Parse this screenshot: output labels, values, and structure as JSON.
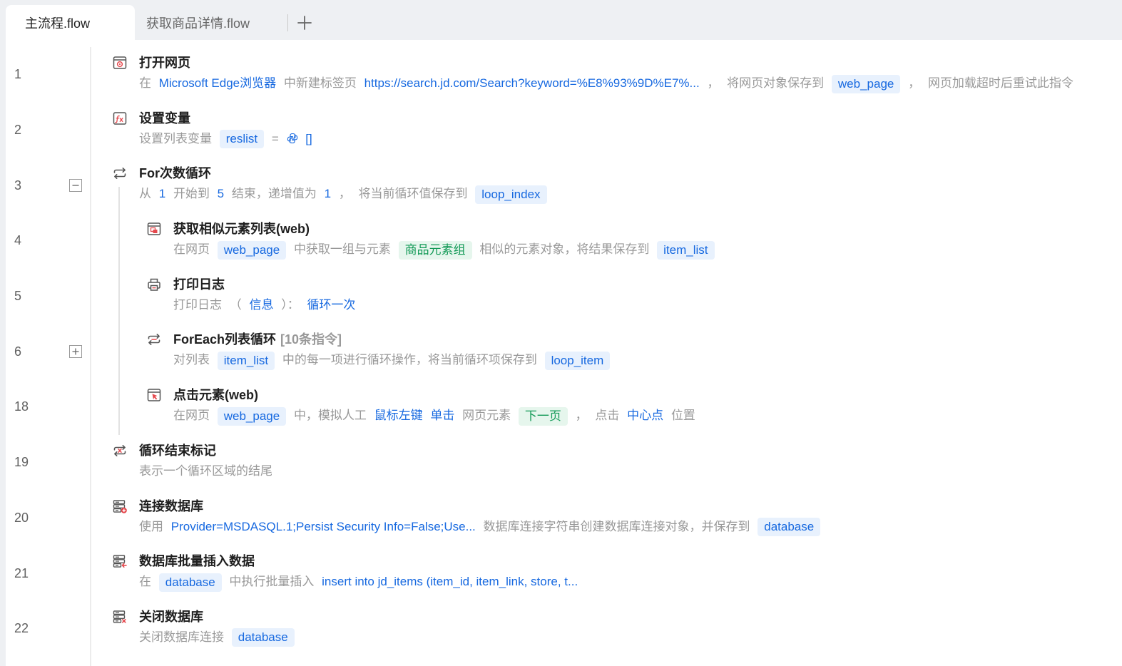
{
  "tabs": [
    {
      "label": "主流程.flow"
    },
    {
      "label": "获取商品详情.flow"
    }
  ],
  "colors": {
    "value_blue": "#1769e0",
    "tag_blue_bg": "#e8f1fd",
    "element_green": "#139a57",
    "tag_green_bg": "#e6f6ed",
    "muted_text": "#999999",
    "icon_red": "#e5484d",
    "icon_gray": "#555555"
  },
  "rows": [
    {
      "line": "1",
      "icon": "open-webpage-icon",
      "title": "打开网页",
      "desc": [
        "在",
        "Microsoft Edge浏览器",
        "中新建标签页",
        "https://search.jd.com/Search?keyword=%E8%93%9D%E7%...",
        "，",
        "将网页对象保存到",
        "web_page",
        "，",
        "网页加载超时后重试此指令"
      ]
    },
    {
      "line": "2",
      "icon": "set-variable-icon",
      "title": "设置变量",
      "value_icon": "python-icon",
      "desc": [
        "设置列表变量",
        "reslist",
        "=",
        "[]"
      ]
    },
    {
      "line": "3",
      "icon": "loop-icon",
      "title": "For次数循环",
      "fold_icon": "minus-icon",
      "desc": [
        "从",
        "1",
        "开始到",
        "5",
        "结束，递增值为",
        "1",
        "，",
        "将当前循环值保存到",
        "loop_index"
      ]
    },
    {
      "line": "4",
      "icon": "similar-elements-icon",
      "title": "获取相似元素列表(web)",
      "desc": [
        "在网页",
        "web_page",
        "中获取一组与元素",
        "商品元素组",
        "相似的元素对象，将结果保存到",
        "item_list"
      ]
    },
    {
      "line": "5",
      "icon": "print-icon",
      "title": "打印日志",
      "desc": [
        "打印日志",
        "（",
        "信息",
        "）：",
        "循环一次"
      ]
    },
    {
      "line": "6",
      "icon": "foreach-loop-icon",
      "title": "ForEach列表循环",
      "title_suffix": "[10条指令]",
      "fold_icon": "plus-icon",
      "desc": [
        "对列表",
        "item_list",
        "中的每一项进行循环操作，将当前循环项保存到",
        "loop_item"
      ]
    },
    {
      "line": "18",
      "icon": "click-element-icon",
      "title": "点击元素(web)",
      "desc": [
        "在网页",
        "web_page",
        "中，模拟人工",
        "鼠标左键",
        "单击",
        "网页元素",
        "下一页",
        "，",
        "点击",
        "中心点",
        "位置"
      ]
    },
    {
      "line": "19",
      "icon": "loop-end-icon",
      "title": "循环结束标记",
      "desc": [
        "表示一个循环区域的结尾"
      ]
    },
    {
      "line": "20",
      "icon": "database-connect-icon",
      "title": "连接数据库",
      "desc": [
        "使用",
        "Provider=MSDASQL.1;Persist Security Info=False;Use...",
        "数据库连接字符串创建数据库连接对象，并保存到",
        "database"
      ]
    },
    {
      "line": "21",
      "icon": "database-insert-icon",
      "title": "数据库批量插入数据",
      "desc": [
        "在",
        "database",
        "中执行批量插入",
        "insert into jd_items (item_id, item_link, store, t..."
      ]
    },
    {
      "line": "22",
      "icon": "database-close-icon",
      "title": "关闭数据库",
      "desc": [
        "关闭数据库连接",
        "database"
      ]
    }
  ]
}
